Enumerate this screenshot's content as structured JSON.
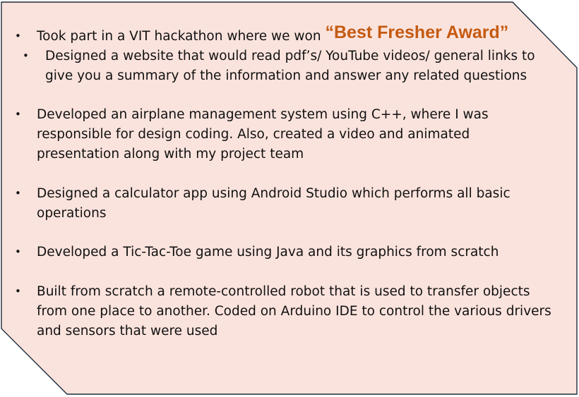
{
  "items": [
    {
      "text": "Took part in a VIT hackathon where we won ",
      "highlight": "“Best Fresher Award”",
      "sub": "Designed a website that would read pdf’s/ YouTube videos/ general links to give you a summary of the information and answer any related questions"
    },
    {
      "text": "Developed an airplane management system using C++, where I was responsible for design coding. Also, created a video and animated presentation along with my project team"
    },
    {
      "text": "Designed a calculator app using Android Studio which performs all basic operations"
    },
    {
      "text": "Developed a Tic-Tac-Toe game using Java and its graphics from scratch"
    },
    {
      "text": "Built from scratch a remote-controlled robot that is used to transfer objects from one place to another. Coded on Arduino IDE to control the various drivers and sensors that were used"
    }
  ],
  "colors": {
    "card_fill": "#fbe3dd",
    "card_border": "#1f2d3d",
    "highlight": "#c55a11",
    "text": "#111111"
  }
}
